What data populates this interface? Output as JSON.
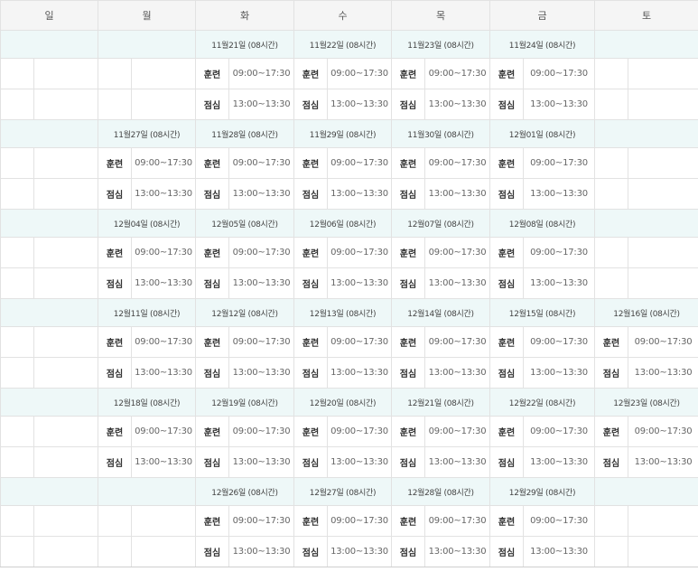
{
  "weekdays": [
    "일",
    "월",
    "화",
    "수",
    "목",
    "금",
    "토"
  ],
  "labels": {
    "train": "훈련",
    "lunch": "점심"
  },
  "times": {
    "train": "09:00~17:30",
    "lunch": "13:00~13:30"
  },
  "weeks": [
    [
      "",
      "",
      "11월21일 (08시간)",
      "11월22일 (08시간)",
      "11월23일 (08시간)",
      "11월24일 (08시간)",
      ""
    ],
    [
      "",
      "11월27일 (08시간)",
      "11월28일 (08시간)",
      "11월29일 (08시간)",
      "11월30일 (08시간)",
      "12월01일 (08시간)",
      ""
    ],
    [
      "",
      "12월04일 (08시간)",
      "12월05일 (08시간)",
      "12월06일 (08시간)",
      "12월07일 (08시간)",
      "12월08일 (08시간)",
      ""
    ],
    [
      "",
      "12월11일 (08시간)",
      "12월12일 (08시간)",
      "12월13일 (08시간)",
      "12월14일 (08시간)",
      "12월15일 (08시간)",
      "12월16일 (08시간)"
    ],
    [
      "",
      "12월18일 (08시간)",
      "12월19일 (08시간)",
      "12월20일 (08시간)",
      "12월21일 (08시간)",
      "12월22일 (08시간)",
      "12월23일 (08시간)"
    ],
    [
      "",
      "",
      "12월26일 (08시간)",
      "12월27일 (08시간)",
      "12월28일 (08시간)",
      "12월29일 (08시간)",
      ""
    ]
  ]
}
